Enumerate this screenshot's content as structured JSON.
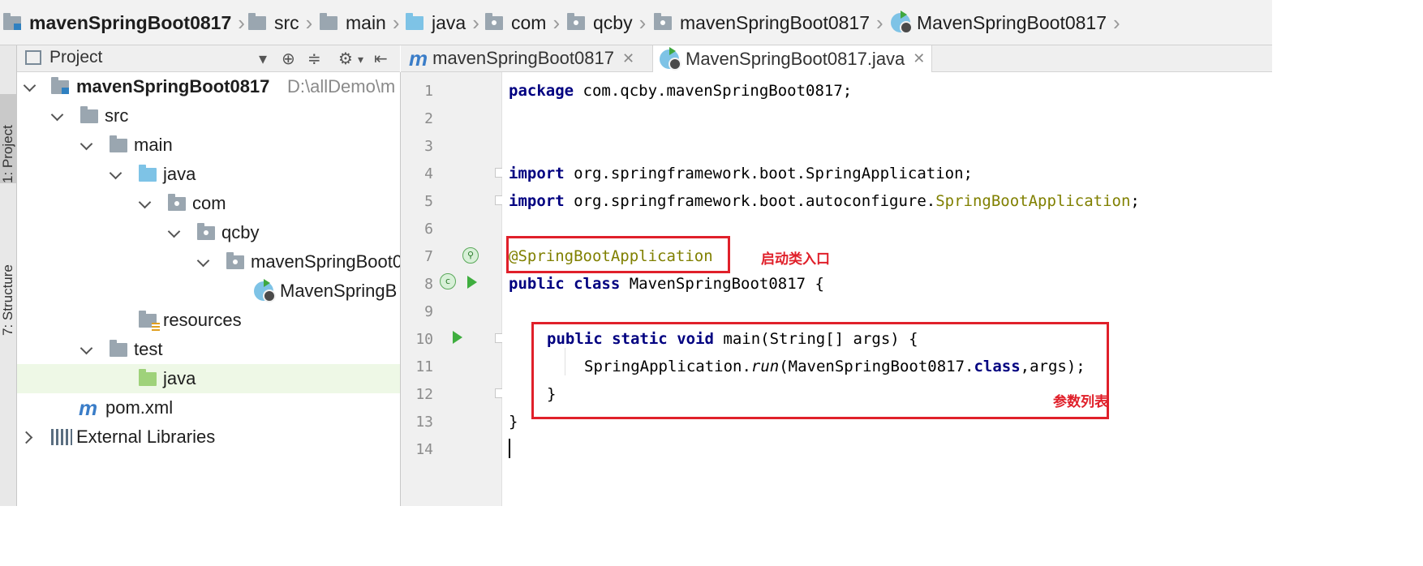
{
  "breadcrumb": [
    "mavenSpringBoot0817",
    "src",
    "main",
    "java",
    "com",
    "qcby",
    "mavenSpringBoot0817",
    "MavenSpringBoot0817"
  ],
  "side_tabs": {
    "project": "1: Project",
    "structure": "7: Structure"
  },
  "project_panel": {
    "title": "Project",
    "root": {
      "name": "mavenSpringBoot0817",
      "path": "D:\\allDemo\\m"
    },
    "items": [
      "src",
      "main",
      "java",
      "com",
      "qcby",
      "mavenSpringBoot0",
      "MavenSpringB",
      "resources",
      "test",
      "java",
      "pom.xml",
      "External Libraries"
    ]
  },
  "editor": {
    "tabs": [
      {
        "label": "mavenSpringBoot0817",
        "icon": "maven-icon"
      },
      {
        "label": "MavenSpringBoot0817.java",
        "icon": "spring-boot-class-icon"
      }
    ],
    "active_tab": 1,
    "line_numbers": [
      "1",
      "2",
      "3",
      "4",
      "5",
      "6",
      "7",
      "8",
      "9",
      "10",
      "11",
      "12",
      "13",
      "14"
    ],
    "current_line": 14
  },
  "code": {
    "l1_kw": "package",
    "l1_rest": " com.qcby.mavenSpringBoot0817;",
    "l4_kw": "import",
    "l4_rest": " org.springframework.boot.SpringApplication;",
    "l5_kw": "import",
    "l5_rest": " org.springframework.boot.autoconfigure.",
    "l5_ann": "SpringBootApplication",
    "l5_end": ";",
    "l7_ann": "@SpringBootApplication",
    "l8_kw1": "public",
    "l8_kw2": "class",
    "l8_rest": " MavenSpringBoot0817 {",
    "l10_kw1": "public",
    "l10_kw2": "static",
    "l10_kw3": "void",
    "l10_rest": " main(String[] args) {",
    "l11_a": "SpringApplication.",
    "l11_run": "run",
    "l11_b": "(MavenSpringBoot0817.",
    "l11_kw": "class",
    "l11_c": ",args);",
    "l12": "}",
    "l13": "}"
  },
  "annotations": {
    "startup": "启动类入口",
    "params": "参数列表"
  },
  "colors": {
    "keyword": "#000080",
    "annotation": "#808000",
    "highlight_box": "#e0202a",
    "current_line": "#fffae3"
  }
}
